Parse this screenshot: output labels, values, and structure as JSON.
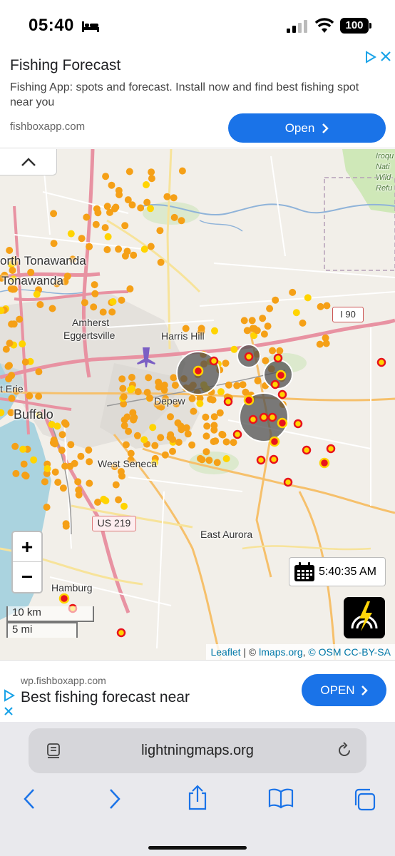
{
  "status": {
    "time": "05:40",
    "battery": "100"
  },
  "top_ad": {
    "title": "Fishing Forecast",
    "description": "Fishing App: spots and forecast. Install now and find best fishing spot near you",
    "url": "fishboxapp.com",
    "button_label": "Open"
  },
  "map": {
    "labels": {
      "north_tonawanda": "orth Tonawanda",
      "tonawanda": "Tonawanda",
      "amherst": "Amherst",
      "eggertsville": "Eggertsville",
      "harris_hill": "Harris Hill",
      "depew": "Depew",
      "erie": "t Erie",
      "buffalo": "Buffalo",
      "west_seneca": "West Seneca",
      "east_aurora": "East Aurora",
      "hamburg": "Hamburg",
      "wildlife_refuge": "Iroqu Nati Wild Refu"
    },
    "route_shields": {
      "i90": "I 90",
      "us219": "US 219"
    },
    "zoom_in": "+",
    "zoom_out": "−",
    "scale_km": "10 km",
    "scale_mi": "5 mi",
    "timestamp": "5:40:35 AM",
    "attribution": {
      "leaflet": "Leaflet",
      "sep1": " | © ",
      "lmaps": "lmaps.org",
      "sep2": ", ",
      "osm": "© OSM CC-BY-SA"
    },
    "strike_colors": {
      "recent": "#e8121c",
      "mid": "#ffd400",
      "old": "#f5a017"
    }
  },
  "bottom_ad": {
    "url": "wp.fishboxapp.com",
    "title": "Best fishing forecast near",
    "button_label": "OPEN"
  },
  "browser": {
    "url": "lightningmaps.org"
  },
  "icons": [
    "bed-icon",
    "signal-icon",
    "wifi-icon",
    "adchoices-icon",
    "close-icon",
    "chevron-up-icon",
    "calendar-icon",
    "lightning-logo-icon",
    "reader-icon",
    "reload-icon",
    "back-icon",
    "forward-icon",
    "share-icon",
    "bookmarks-icon",
    "tabs-icon"
  ]
}
